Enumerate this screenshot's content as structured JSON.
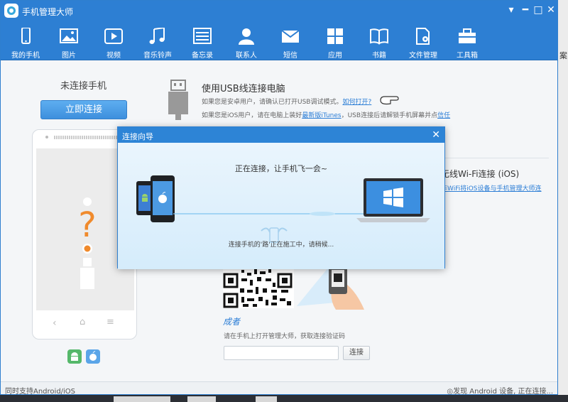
{
  "window": {
    "title": "手机管理大师"
  },
  "toolbar": {
    "items": [
      {
        "label": "我的手机",
        "icon": "phone-icon"
      },
      {
        "label": "图片",
        "icon": "picture-icon"
      },
      {
        "label": "视频",
        "icon": "video-icon"
      },
      {
        "label": "音乐铃声",
        "icon": "music-icon"
      },
      {
        "label": "备忘录",
        "icon": "memo-icon"
      },
      {
        "label": "联系人",
        "icon": "contact-icon"
      },
      {
        "label": "短信",
        "icon": "sms-icon"
      },
      {
        "label": "应用",
        "icon": "apps-icon"
      },
      {
        "label": "书籍",
        "icon": "book-icon"
      },
      {
        "label": "文件管理",
        "icon": "file-manage-icon"
      },
      {
        "label": "工具箱",
        "icon": "toolbox-icon"
      }
    ]
  },
  "left": {
    "status": "未连接手机",
    "connect_button": "立即连接"
  },
  "usb": {
    "title": "使用USB线连接电脑",
    "line1": "如果您是安卓用户，请确认已打开USB调试模式。",
    "line1_link": "如何打开?",
    "line2": "如果您是iOS用户，请在电脑上装好",
    "line2_link": "最新版iTunes",
    "line2_rest": "，USB连接后请解锁手机屏幕并点",
    "line2_link2": "信任"
  },
  "wifi": {
    "title": "无线Wi-Fi连接 (iOS)",
    "desc": "非WiFi将iOS设备与手机管理大师连"
  },
  "code": {
    "success": "成者",
    "hint": "请在手机上打开管理大师，获取连接验证码",
    "input_placeholder": "",
    "button": "连接"
  },
  "dialog": {
    "title": "连接向导",
    "message": "正在连接，让手机飞一会~",
    "submessage": "连接手机的'路'正在施工中，请稍候..."
  },
  "status": {
    "left": "同时支持Android/iOS",
    "right": "◎发现 Android 设备, 正在连接..."
  },
  "edge_fragment": "案\""
}
